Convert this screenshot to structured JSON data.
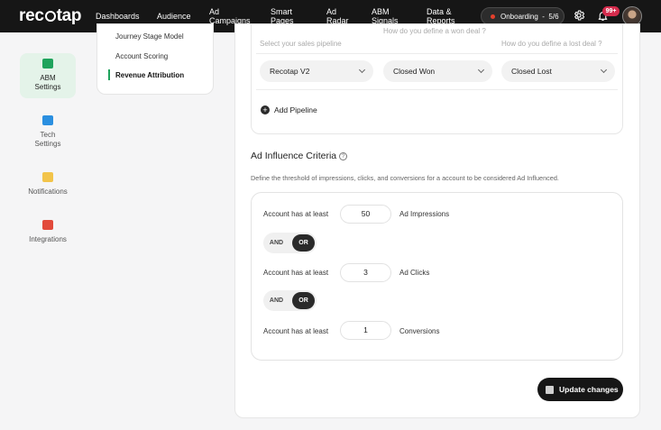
{
  "brand": {
    "logo_text_pre": "rec",
    "logo_text_post": "tap"
  },
  "topnav": [
    {
      "l1": "Dashboards",
      "l2": ""
    },
    {
      "l1": "Audience",
      "l2": ""
    },
    {
      "l1": "Ad",
      "l2": "Campaigns"
    },
    {
      "l1": "Smart",
      "l2": "Pages"
    },
    {
      "l1": "Ad",
      "l2": "Radar"
    },
    {
      "l1": "ABM",
      "l2": "Signals"
    },
    {
      "l1": "Data &",
      "l2": "Reports"
    }
  ],
  "onboarding": {
    "label": "Onboarding",
    "progress": "5/6",
    "dot_color": "#e4402c"
  },
  "notifications": {
    "count": "99+",
    "badge_color": "#d42b4c"
  },
  "sidebar": [
    {
      "l1": "ABM",
      "l2": "Settings",
      "icon": "abm-settings-icon",
      "active": true,
      "color": "#1fa35c"
    },
    {
      "l1": "Tech",
      "l2": "Settings",
      "icon": "tech-settings-icon",
      "color": "#2a8fe0"
    },
    {
      "l1": "Notifications",
      "l2": "",
      "icon": "notifications-icon",
      "color": "#f2c44a"
    },
    {
      "l1": "Integrations",
      "l2": "",
      "icon": "integrations-icon",
      "color": "#e24a3b"
    }
  ],
  "submenu": [
    "Journey Stage Model",
    "Account Scoring",
    "Revenue Attribution"
  ],
  "submenu_active": "Revenue Attribution",
  "pipeline": {
    "col1_label": "Select your sales pipeline",
    "col2_label": "How do you define a won deal ?",
    "col3_label": "How do you define a lost deal ?",
    "pipeline_value": "Recotap V2",
    "won_value": "Closed Won",
    "lost_value": "Closed Lost",
    "add_label": "Add Pipeline"
  },
  "influence": {
    "title": "Ad Influence Criteria",
    "help_glyph": "?",
    "description": "Define the threshold of impressions, clicks, and conversions for a account to be considered Ad Influenced.",
    "rows": [
      {
        "prefix": "Account has at least",
        "value": "50",
        "unit": "Ad Impressions"
      },
      {
        "prefix": "Account has at least",
        "value": "3",
        "unit": "Ad Clicks"
      },
      {
        "prefix": "Account has at least",
        "value": "1",
        "unit": "Conversions"
      }
    ],
    "toggles": [
      {
        "and": "AND",
        "or": "OR",
        "selected": "OR"
      },
      {
        "and": "AND",
        "or": "OR",
        "selected": "OR"
      }
    ]
  },
  "update_button": "Update changes"
}
